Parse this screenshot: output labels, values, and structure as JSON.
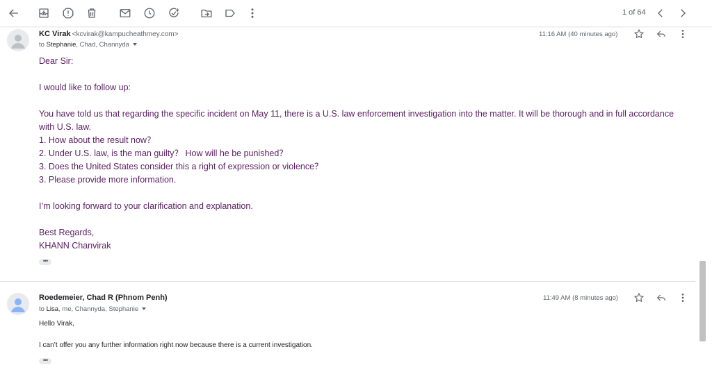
{
  "pager": {
    "text": "1 of 64"
  },
  "toolbar": {
    "icons": [
      "back-arrow-icon",
      "archive-icon",
      "report-spam-icon",
      "delete-icon",
      "mark-unread-icon",
      "snooze-icon",
      "add-task-icon",
      "move-to-icon",
      "label-icon",
      "more-vert-icon",
      "prev-icon",
      "next-icon"
    ]
  },
  "message1": {
    "sender_name": "KC Virak",
    "sender_email": "<kcvirak@kampucheathmey.com>",
    "to_prefix": "to",
    "to_first": "Stephanie",
    "to_rest": ", Chad, Channyda",
    "time": "11:16 AM (40 minutes ago)",
    "lines": {
      "greeting": "Dear Sir:",
      "followup": "I would like to follow up:",
      "p1a": "You have told us that regarding the specific incident on May 11, there is a U.S. law enforcement investigation into the matter.  It will be thorough and in full accordance",
      "p1b": "with U.S. law.",
      "q1": "1. How about the result now？",
      "q2": "2. Under U.S. law, is the man guilty？ How will he be punished？",
      "q3": "3. Does the United States consider this a right of expression or violence？",
      "q4": "3. Please provide more information.",
      "closing": "I’m looking forward to your clarification and explanation.",
      "regards": "Best Regards,",
      "name": "KHANN Chanvirak"
    },
    "dots": "•••"
  },
  "message2": {
    "sender_name": "Roedemeier, Chad R (Phnom Penh)",
    "to_prefix": "to",
    "to_first": "Lisa",
    "to_rest": ", me, Channyda, Stephanie",
    "time": "11:49 AM (8 minutes ago)",
    "lines": {
      "greeting": "Hello Virak,",
      "body": "I can’t offer you any further information right now because there  is a current investigation."
    },
    "dots": "•••"
  }
}
